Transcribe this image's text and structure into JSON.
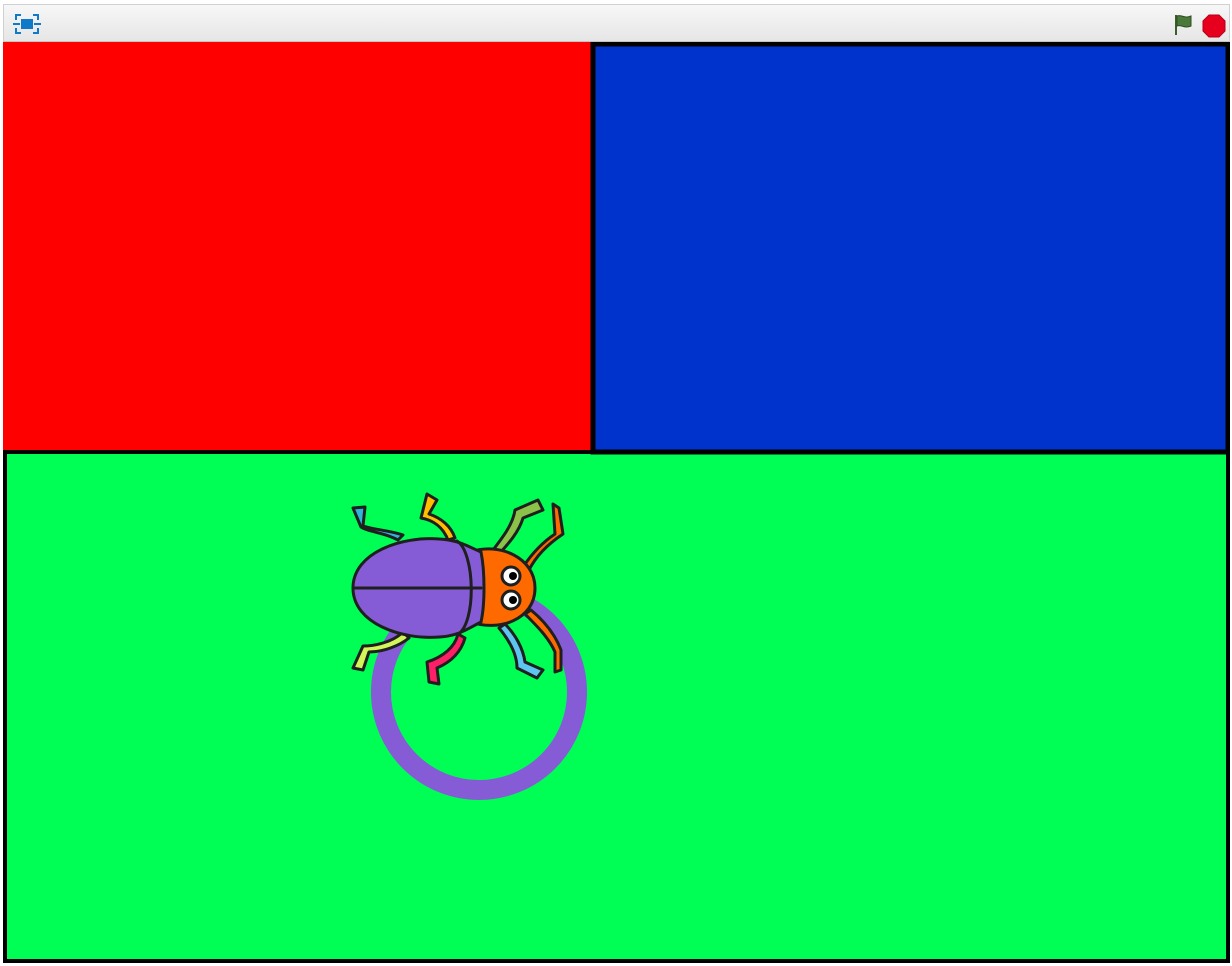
{
  "toolbar": {
    "fullscreen_icon": "fullscreen-icon",
    "green_flag_icon": "green-flag-icon",
    "stop_icon": "stop-sign-icon"
  },
  "stage": {
    "regions": [
      {
        "name": "red-region",
        "color": "#ff0000"
      },
      {
        "name": "blue-region",
        "color": "#0033cc"
      },
      {
        "name": "green-region",
        "color": "#00ff55"
      }
    ],
    "sprite": {
      "name": "beetle",
      "body_color": "#855cd6",
      "head_color": "#ff6a00"
    },
    "pen_trail": {
      "shape": "circle",
      "color": "#855cd6"
    }
  },
  "colors": {
    "accent_blue": "#0f7ac7",
    "flag_green": "#4a7a3a",
    "stop_red": "#e6001e",
    "outline": "#000000"
  }
}
